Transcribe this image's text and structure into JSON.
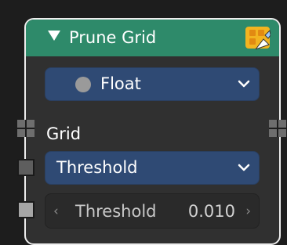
{
  "node": {
    "title": "Prune Grid",
    "header_color": "#2e8a6a",
    "collapse_icon": "triangle-down-icon",
    "badge_icon": "node-grid-tool-icon"
  },
  "data_type": {
    "value": "Float",
    "dot_color": "#9a9a9a"
  },
  "sockets": {
    "grid_label": "Grid"
  },
  "mode": {
    "value": "Threshold"
  },
  "threshold_field": {
    "label": "Threshold",
    "value": "0.010",
    "left_arrow": "‹",
    "right_arrow": "›"
  }
}
